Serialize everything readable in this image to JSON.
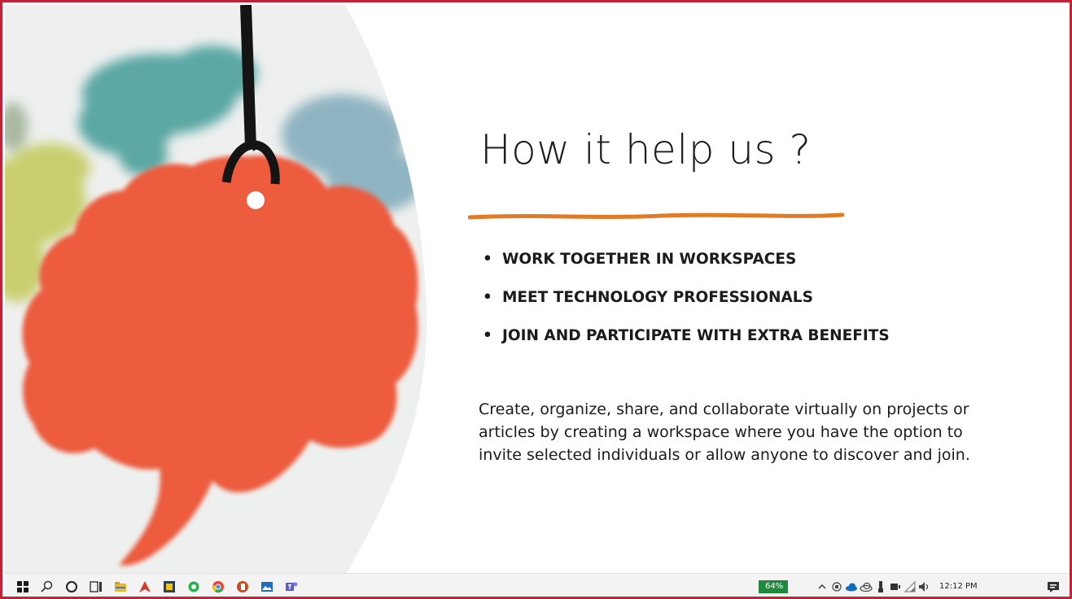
{
  "slide": {
    "title": "How it help us ?",
    "bullet_marker": "•",
    "bullets": [
      "WORK TOGETHER IN WORKSPACES",
      "MEET TECHNOLOGY PROFESSIONALS",
      "JOIN AND PARTICIPATE WITH EXTRA BENEFITS"
    ],
    "body": "Create, organize, share, and collaborate virtually on projects or articles by creating a workspace where you have the option to invite selected individuals or allow anyone to discover and join.",
    "colors": {
      "underline": "#e07a24",
      "speech_bubble": "#ec5b3c",
      "frame_border": "#c0223a"
    }
  },
  "taskbar": {
    "icons": [
      "windows-start-icon",
      "search-icon",
      "cortana-icon",
      "task-view-icon",
      "file-explorer-icon",
      "app-icon",
      "app-icon",
      "app-icon",
      "chrome-icon",
      "powerpoint-icon",
      "app-icon",
      "teams-icon"
    ],
    "battery_label": "64%",
    "tray_icons": [
      "chevron-up-icon",
      "tray-app-icon",
      "onedrive-icon",
      "onedrive-icon",
      "usb-icon",
      "display-icon",
      "network-icon",
      "volume-icon"
    ],
    "clock": "12:12 PM",
    "notification_icon": "notification-icon"
  }
}
